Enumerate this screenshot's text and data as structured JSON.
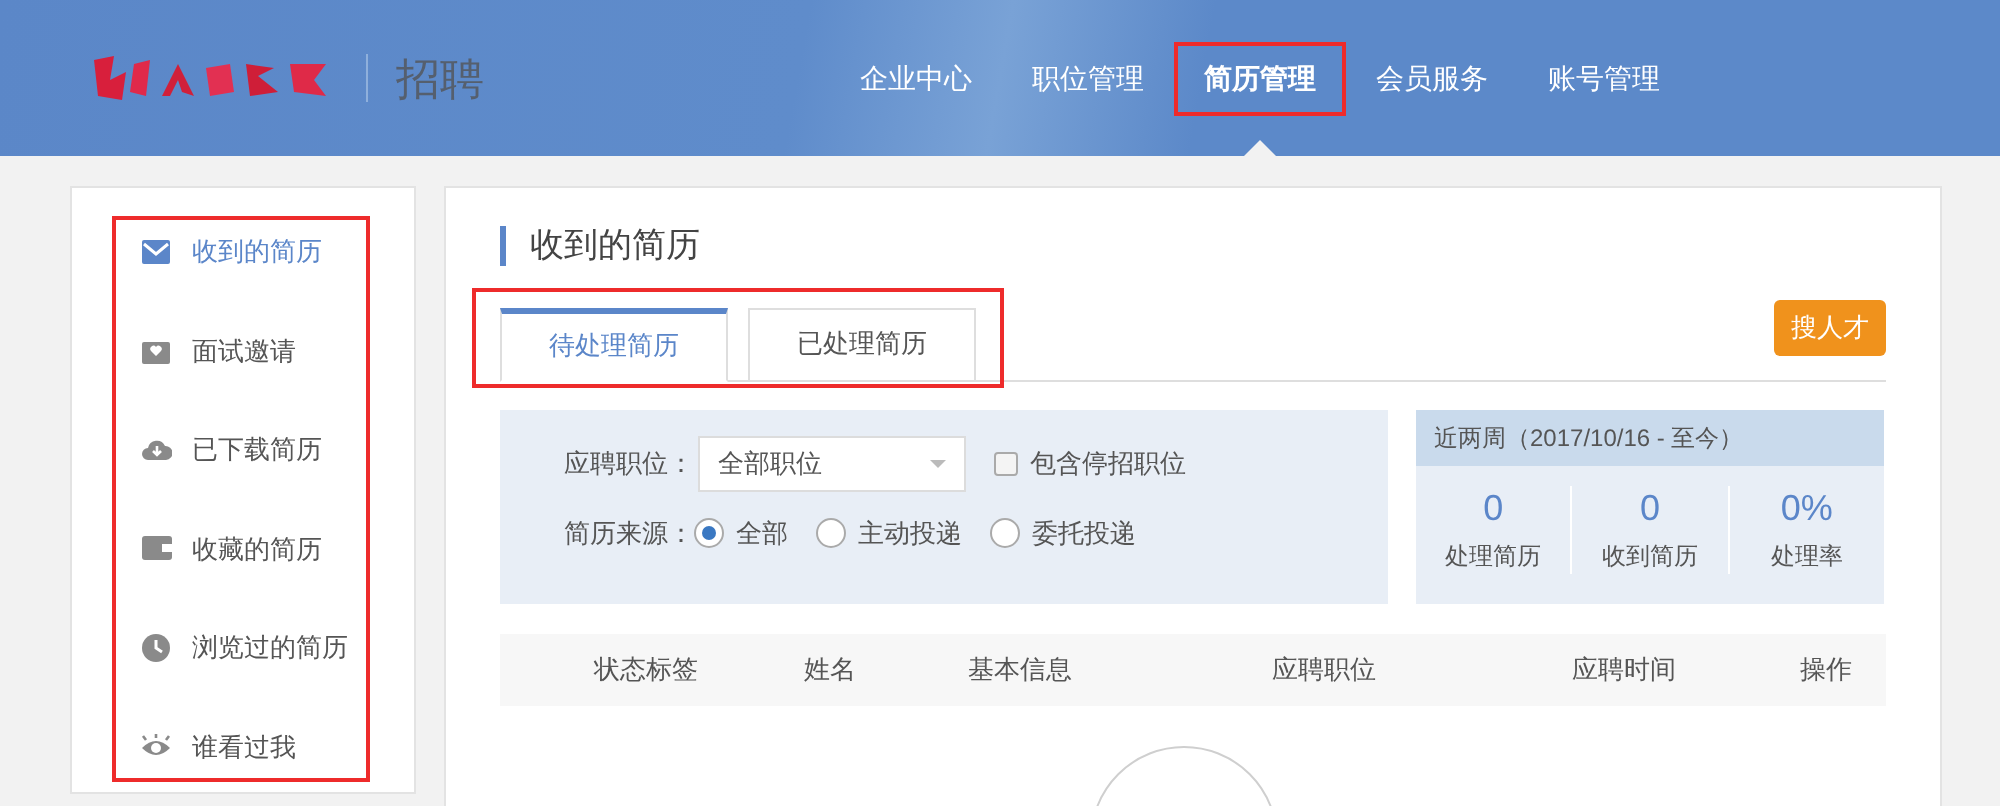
{
  "header": {
    "brand": "招聘",
    "nav": [
      {
        "label": "企业中心",
        "selected": false,
        "highlighted": false
      },
      {
        "label": "职位管理",
        "selected": false,
        "highlighted": false
      },
      {
        "label": "简历管理",
        "selected": true,
        "highlighted": true
      },
      {
        "label": "会员服务",
        "selected": false,
        "highlighted": false
      },
      {
        "label": "账号管理",
        "selected": false,
        "highlighted": false
      }
    ]
  },
  "sidebar": {
    "highlighted": true,
    "items": [
      {
        "label": "收到的简历",
        "kind": "inbox",
        "selected": true
      },
      {
        "label": "面试邀请",
        "kind": "invite",
        "selected": false
      },
      {
        "label": "已下载简历",
        "kind": "download",
        "selected": false
      },
      {
        "label": "收藏的简历",
        "kind": "wallet",
        "selected": false
      },
      {
        "label": "浏览过的简历",
        "kind": "clock",
        "selected": false
      },
      {
        "label": "谁看过我",
        "kind": "eye",
        "selected": false
      }
    ]
  },
  "main": {
    "title": "收到的简历",
    "tabs_highlighted": true,
    "tabs": [
      {
        "label": "待处理简历",
        "selected": true
      },
      {
        "label": "已处理简历",
        "selected": false
      }
    ],
    "search_button": "搜人才",
    "filters": {
      "position_label": "应聘职位：",
      "position_value": "全部职位",
      "include_closed": {
        "label": "包含停招职位",
        "checked": false
      },
      "source_label": "简历来源：",
      "sources": [
        {
          "label": "全部",
          "selected": true
        },
        {
          "label": "主动投递",
          "selected": false
        },
        {
          "label": "委托投递",
          "selected": false
        }
      ]
    },
    "stats": {
      "title": "近两周（2017/10/16 - 至今）",
      "items": [
        {
          "value": "0",
          "label": "处理简历"
        },
        {
          "value": "0",
          "label": "收到简历"
        },
        {
          "value": "0%",
          "label": "处理率"
        }
      ]
    },
    "table": {
      "columns": [
        "状态标签",
        "姓名",
        "基本信息",
        "应聘职位",
        "应聘时间",
        "操作"
      ]
    }
  }
}
